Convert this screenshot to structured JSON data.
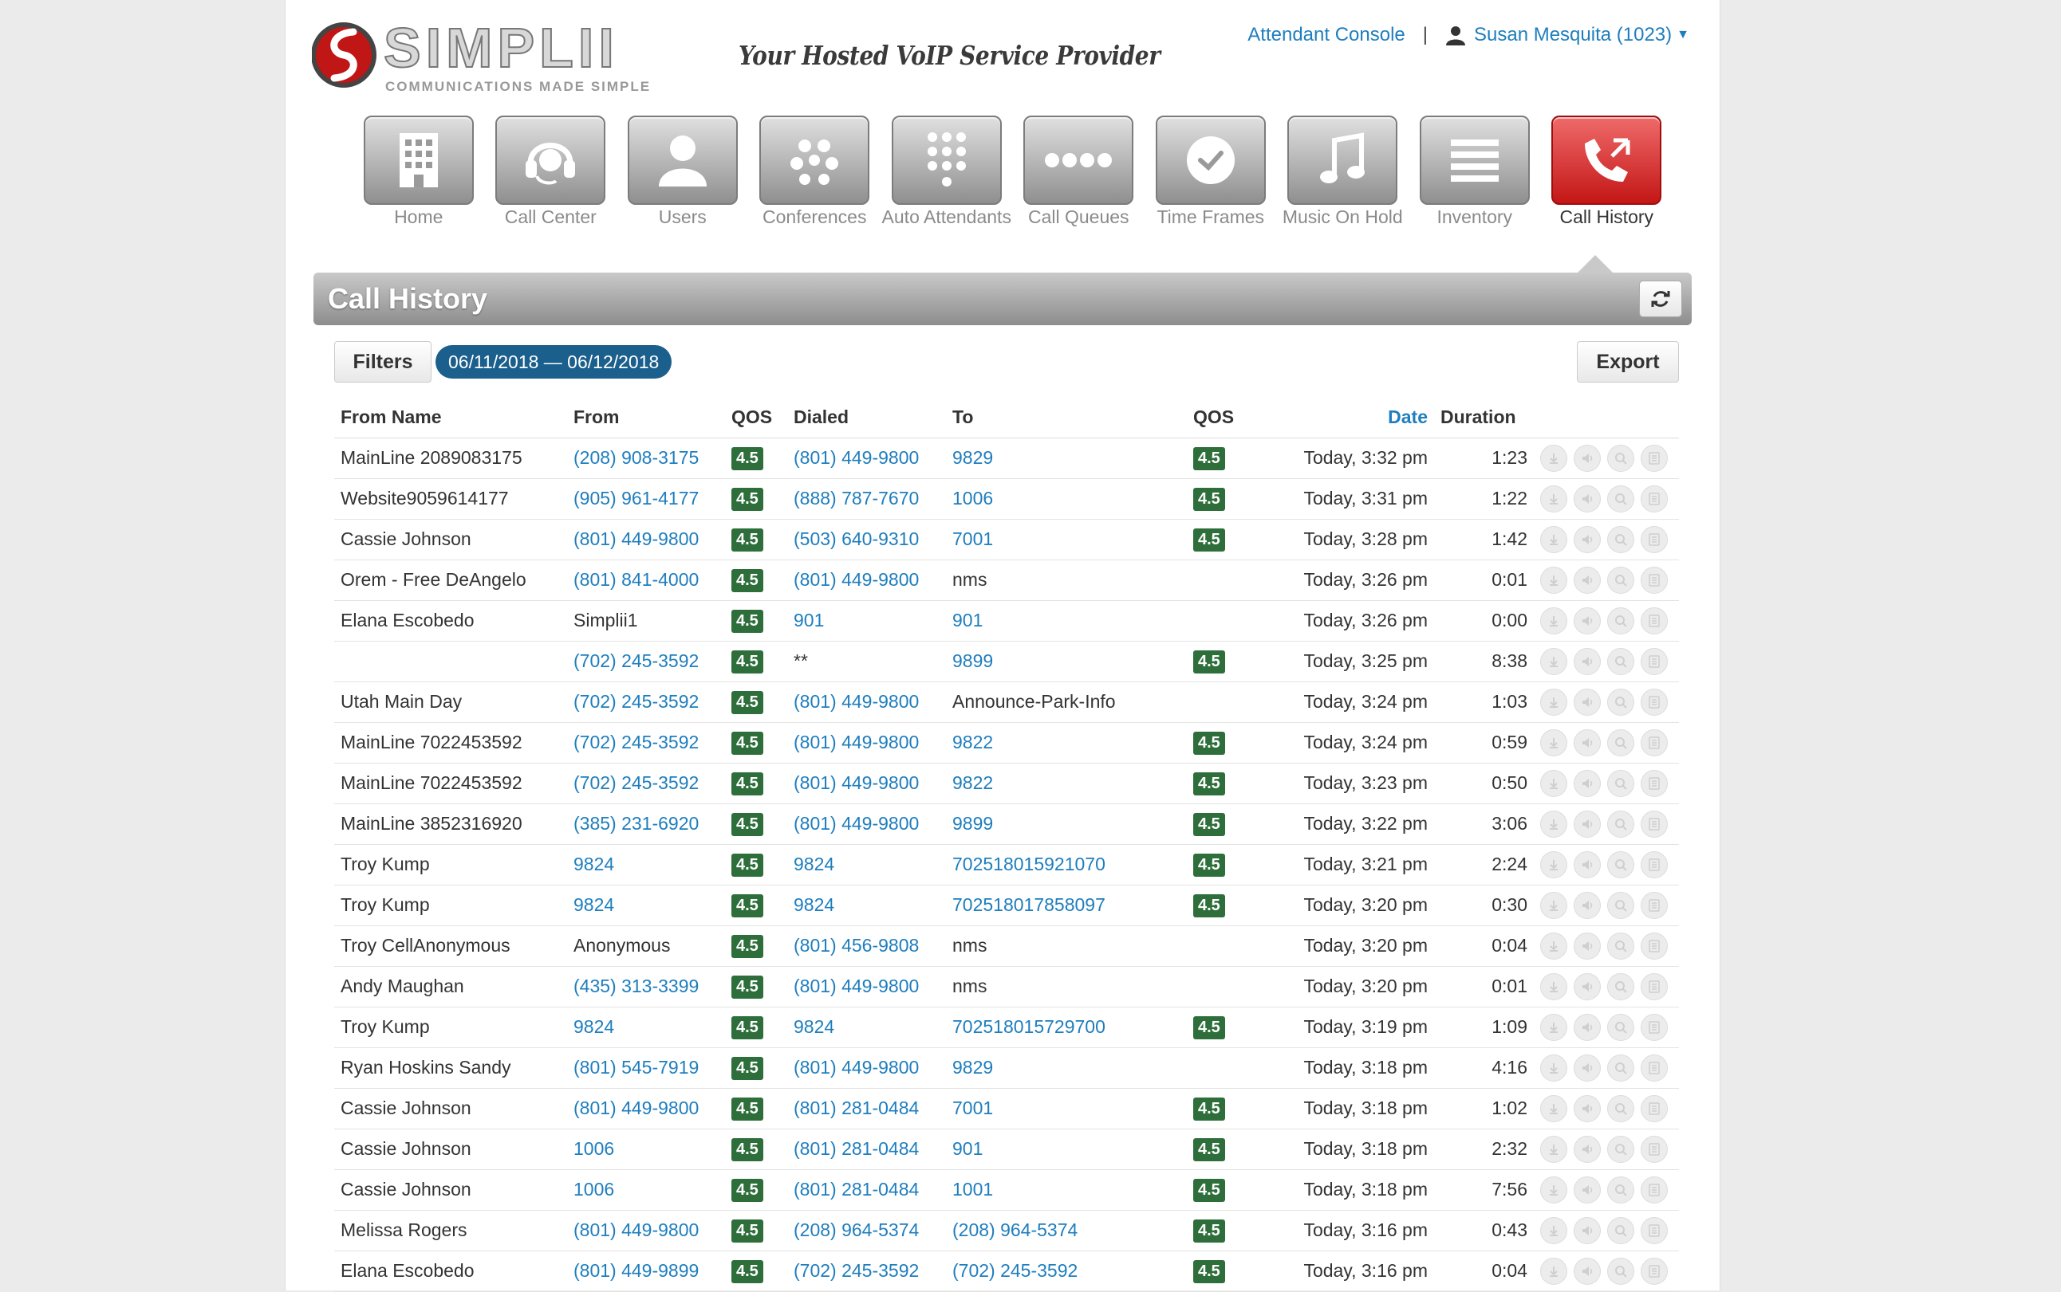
{
  "header": {
    "tagline": "Your Hosted VoIP Service Provider",
    "logo_text": "SIMPLII",
    "logo_subtext": "COMMUNICATIONS MADE SIMPLE",
    "attendant_console": "Attendant Console",
    "separator": "|",
    "user": "Susan Mesquita (1023)"
  },
  "nav": [
    {
      "label": "Home",
      "icon": "building-icon"
    },
    {
      "label": "Call Center",
      "icon": "headset-icon"
    },
    {
      "label": "Users",
      "icon": "user-icon"
    },
    {
      "label": "Conferences",
      "icon": "dots-cluster-icon"
    },
    {
      "label": "Auto Attendants",
      "icon": "keypad-icon"
    },
    {
      "label": "Call Queues",
      "icon": "dots-row-icon"
    },
    {
      "label": "Time Frames",
      "icon": "clock-icon"
    },
    {
      "label": "Music On Hold",
      "icon": "music-note-icon"
    },
    {
      "label": "Inventory",
      "icon": "list-icon"
    },
    {
      "label": "Call History",
      "icon": "phone-arrows-icon",
      "active": true
    }
  ],
  "section": {
    "title": "Call History"
  },
  "toolbar": {
    "filters": "Filters",
    "date_range": "06/11/2018 — 06/12/2018",
    "export": "Export"
  },
  "table": {
    "headers": {
      "from_name": "From Name",
      "from": "From",
      "qos1": "QOS",
      "dialed": "Dialed",
      "to": "To",
      "qos2": "QOS",
      "date": "Date",
      "duration": "Duration"
    },
    "rows": [
      {
        "from_name": "MainLine 2089083175",
        "from": "(208) 908-3175",
        "from_link": true,
        "qos1": "4.5",
        "dialed": "(801) 449-9800",
        "dialed_link": true,
        "to": "9829",
        "to_link": true,
        "qos2": "4.5",
        "date": "Today, 3:32 pm",
        "duration": "1:23"
      },
      {
        "from_name": "Website9059614177",
        "from": "(905) 961-4177",
        "from_link": true,
        "qos1": "4.5",
        "dialed": "(888) 787-7670",
        "dialed_link": true,
        "to": "1006",
        "to_link": true,
        "qos2": "4.5",
        "date": "Today, 3:31 pm",
        "duration": "1:22"
      },
      {
        "from_name": "Cassie Johnson",
        "from": "(801) 449-9800",
        "from_link": true,
        "qos1": "4.5",
        "dialed": "(503) 640-9310",
        "dialed_link": true,
        "to": "7001",
        "to_link": true,
        "qos2": "4.5",
        "date": "Today, 3:28 pm",
        "duration": "1:42"
      },
      {
        "from_name": "Orem - Free DeAngelo",
        "from": "(801) 841-4000",
        "from_link": true,
        "qos1": "4.5",
        "dialed": "(801) 449-9800",
        "dialed_link": true,
        "to": "nms",
        "to_link": false,
        "qos2": "",
        "date": "Today, 3:26 pm",
        "duration": "0:01"
      },
      {
        "from_name": "Elana Escobedo",
        "from": "Simplii1",
        "from_link": false,
        "qos1": "4.5",
        "dialed": "901",
        "dialed_link": true,
        "to": "901",
        "to_link": true,
        "qos2": "",
        "date": "Today, 3:26 pm",
        "duration": "0:00"
      },
      {
        "from_name": "",
        "from": "(702) 245-3592",
        "from_link": true,
        "qos1": "4.5",
        "dialed": "**",
        "dialed_link": false,
        "to": "9899",
        "to_link": true,
        "qos2": "4.5",
        "date": "Today, 3:25 pm",
        "duration": "8:38"
      },
      {
        "from_name": "Utah Main Day",
        "from": "(702) 245-3592",
        "from_link": true,
        "qos1": "4.5",
        "dialed": "(801) 449-9800",
        "dialed_link": true,
        "to": "Announce-Park-Info",
        "to_link": false,
        "qos2": "",
        "date": "Today, 3:24 pm",
        "duration": "1:03"
      },
      {
        "from_name": "MainLine 7022453592",
        "from": "(702) 245-3592",
        "from_link": true,
        "qos1": "4.5",
        "dialed": "(801) 449-9800",
        "dialed_link": true,
        "to": "9822",
        "to_link": true,
        "qos2": "4.5",
        "date": "Today, 3:24 pm",
        "duration": "0:59"
      },
      {
        "from_name": "MainLine 7022453592",
        "from": "(702) 245-3592",
        "from_link": true,
        "qos1": "4.5",
        "dialed": "(801) 449-9800",
        "dialed_link": true,
        "to": "9822",
        "to_link": true,
        "qos2": "4.5",
        "date": "Today, 3:23 pm",
        "duration": "0:50"
      },
      {
        "from_name": "MainLine 3852316920",
        "from": "(385) 231-6920",
        "from_link": true,
        "qos1": "4.5",
        "dialed": "(801) 449-9800",
        "dialed_link": true,
        "to": "9899",
        "to_link": true,
        "qos2": "4.5",
        "date": "Today, 3:22 pm",
        "duration": "3:06"
      },
      {
        "from_name": "Troy Kump",
        "from": "9824",
        "from_link": true,
        "qos1": "4.5",
        "dialed": "9824",
        "dialed_link": true,
        "to": "702518015921070",
        "to_link": true,
        "qos2": "4.5",
        "date": "Today, 3:21 pm",
        "duration": "2:24"
      },
      {
        "from_name": "Troy Kump",
        "from": "9824",
        "from_link": true,
        "qos1": "4.5",
        "dialed": "9824",
        "dialed_link": true,
        "to": "702518017858097",
        "to_link": true,
        "qos2": "4.5",
        "date": "Today, 3:20 pm",
        "duration": "0:30"
      },
      {
        "from_name": "Troy CellAnonymous",
        "from": "Anonymous",
        "from_link": false,
        "qos1": "4.5",
        "dialed": "(801) 456-9808",
        "dialed_link": true,
        "to": "nms",
        "to_link": false,
        "qos2": "",
        "date": "Today, 3:20 pm",
        "duration": "0:04"
      },
      {
        "from_name": "Andy Maughan",
        "from": "(435) 313-3399",
        "from_link": true,
        "qos1": "4.5",
        "dialed": "(801) 449-9800",
        "dialed_link": true,
        "to": "nms",
        "to_link": false,
        "qos2": "",
        "date": "Today, 3:20 pm",
        "duration": "0:01"
      },
      {
        "from_name": "Troy Kump",
        "from": "9824",
        "from_link": true,
        "qos1": "4.5",
        "dialed": "9824",
        "dialed_link": true,
        "to": "702518015729700",
        "to_link": true,
        "qos2": "4.5",
        "date": "Today, 3:19 pm",
        "duration": "1:09"
      },
      {
        "from_name": "Ryan Hoskins Sandy",
        "from": "(801) 545-7919",
        "from_link": true,
        "qos1": "4.5",
        "dialed": "(801) 449-9800",
        "dialed_link": true,
        "to": "9829",
        "to_link": true,
        "qos2": "",
        "date": "Today, 3:18 pm",
        "duration": "4:16"
      },
      {
        "from_name": "Cassie Johnson",
        "from": "(801) 449-9800",
        "from_link": true,
        "qos1": "4.5",
        "dialed": "(801) 281-0484",
        "dialed_link": true,
        "to": "7001",
        "to_link": true,
        "qos2": "4.5",
        "date": "Today, 3:18 pm",
        "duration": "1:02"
      },
      {
        "from_name": "Cassie Johnson",
        "from": "1006",
        "from_link": true,
        "qos1": "4.5",
        "dialed": "(801) 281-0484",
        "dialed_link": true,
        "to": "901",
        "to_link": true,
        "qos2": "4.5",
        "date": "Today, 3:18 pm",
        "duration": "2:32"
      },
      {
        "from_name": "Cassie Johnson",
        "from": "1006",
        "from_link": true,
        "qos1": "4.5",
        "dialed": "(801) 281-0484",
        "dialed_link": true,
        "to": "1001",
        "to_link": true,
        "qos2": "4.5",
        "date": "Today, 3:18 pm",
        "duration": "7:56"
      },
      {
        "from_name": "Melissa Rogers",
        "from": "(801) 449-9800",
        "from_link": true,
        "qos1": "4.5",
        "dialed": "(208) 964-5374",
        "dialed_link": true,
        "to": "(208) 964-5374",
        "to_link": true,
        "qos2": "4.5",
        "date": "Today, 3:16 pm",
        "duration": "0:43"
      },
      {
        "from_name": "Elana Escobedo",
        "from": "(801) 449-9899",
        "from_link": true,
        "qos1": "4.5",
        "dialed": "(702) 245-3592",
        "dialed_link": true,
        "to": "(702) 245-3592",
        "to_link": true,
        "qos2": "4.5",
        "date": "Today, 3:16 pm",
        "duration": "0:04"
      }
    ],
    "row_actions": [
      "download-icon",
      "speaker-icon",
      "magnify-icon",
      "notes-icon"
    ]
  },
  "colors": {
    "link": "#1e7ebe",
    "qos_badge": "#2d6e3b",
    "active_nav": "#d42a2a",
    "date_pill": "#1b5f8c"
  }
}
